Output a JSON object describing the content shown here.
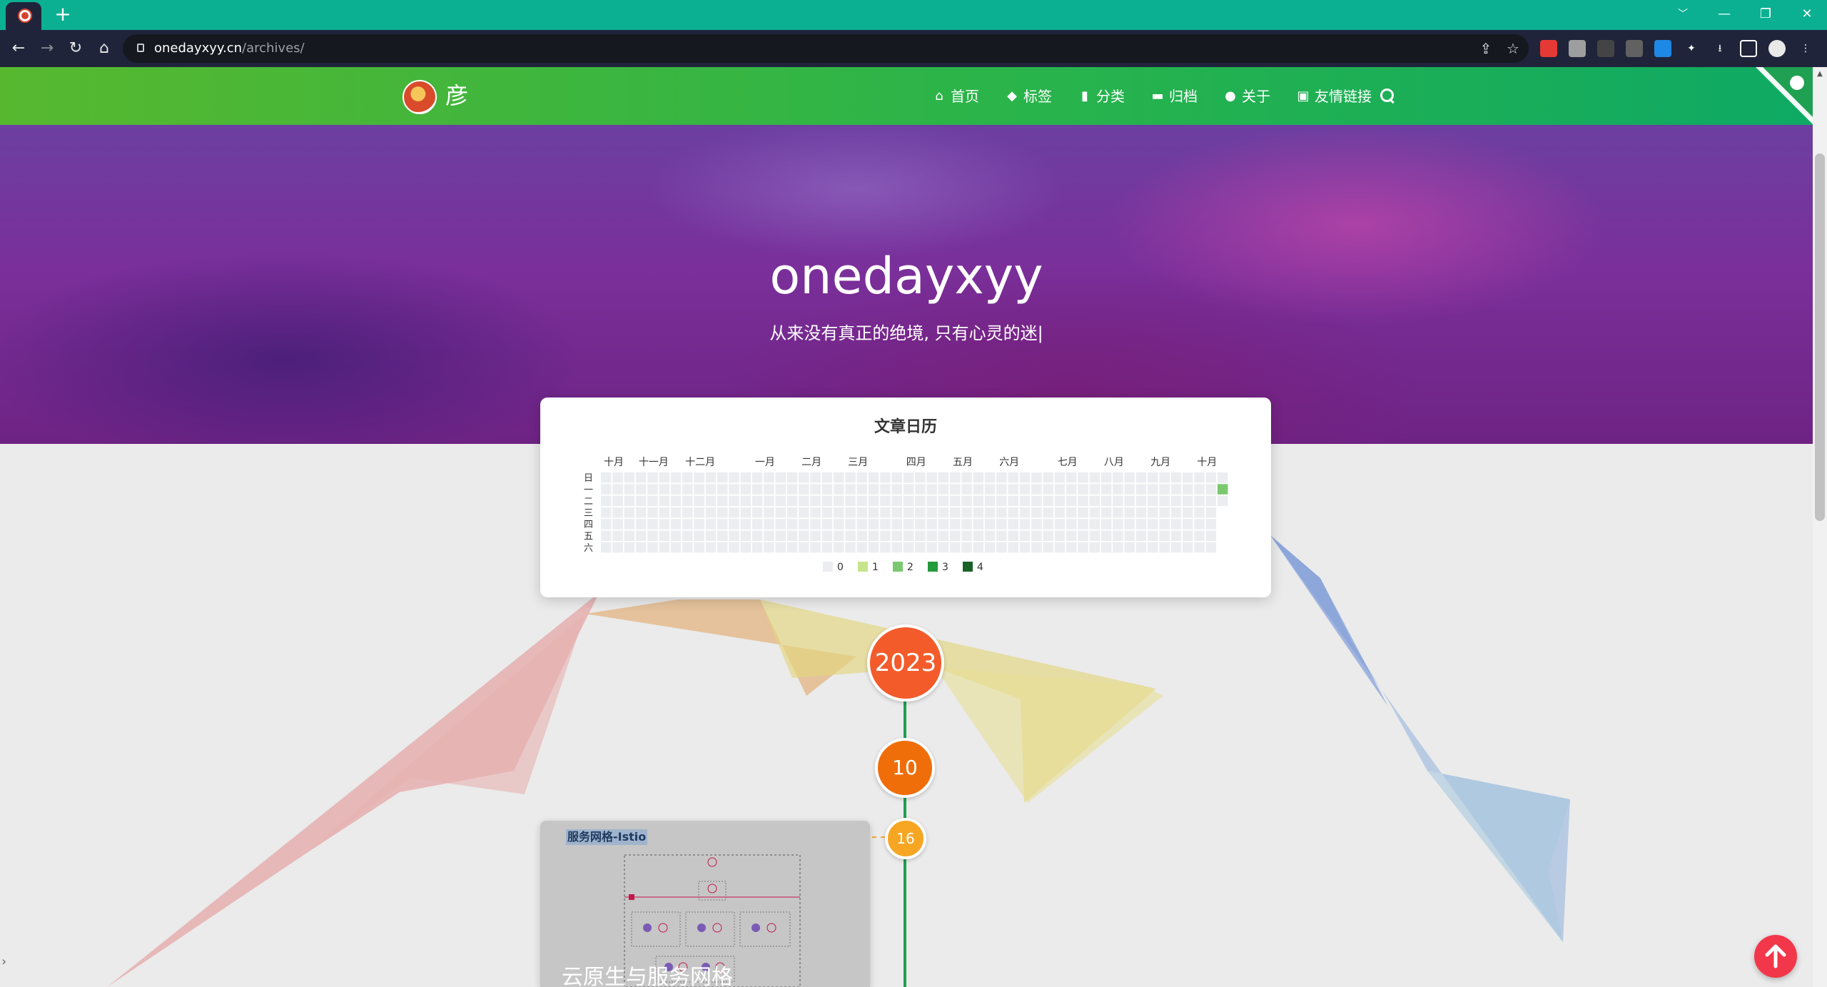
{
  "browser": {
    "new_tab_label": "+",
    "url_host": "onedayxyy.cn",
    "url_path": "/archives/",
    "window_controls": [
      "﹀",
      "—",
      "❐",
      "✕"
    ]
  },
  "site": {
    "logo_text": "彦",
    "menu": [
      {
        "label": "首页",
        "icon": "home-icon"
      },
      {
        "label": "标签",
        "icon": "tags-icon"
      },
      {
        "label": "分类",
        "icon": "bookmark-icon"
      },
      {
        "label": "归档",
        "icon": "archive-icon"
      },
      {
        "label": "关于",
        "icon": "user-circle-icon"
      },
      {
        "label": "友情链接",
        "icon": "address-book-icon"
      }
    ]
  },
  "hero": {
    "title": "onedayxyy",
    "subtitle": "从来没有真正的绝境, 只有心灵的迷|"
  },
  "calendar": {
    "title": "文章日历",
    "months": [
      "十月",
      "十一月",
      "十二月",
      "一月",
      "二月",
      "三月",
      "四月",
      "五月",
      "六月",
      "七月",
      "八月",
      "九月",
      "十月"
    ],
    "weekdays": [
      "日",
      "一",
      "二",
      "三",
      "四",
      "五",
      "六"
    ],
    "legend": [
      {
        "label": "0",
        "color": "#ebedf0"
      },
      {
        "label": "1",
        "color": "#c6e48b"
      },
      {
        "label": "2",
        "color": "#7bc96f"
      },
      {
        "label": "3",
        "color": "#239a3b"
      },
      {
        "label": "4",
        "color": "#196127"
      }
    ],
    "highlight": {
      "week_from_end": 0,
      "weekday": 1,
      "level": 2
    }
  },
  "timeline": {
    "year": "2023",
    "month": "10",
    "day": "16",
    "post": {
      "cover_tag": "服务网格-Istio",
      "title": "云原生与服务网格"
    }
  }
}
